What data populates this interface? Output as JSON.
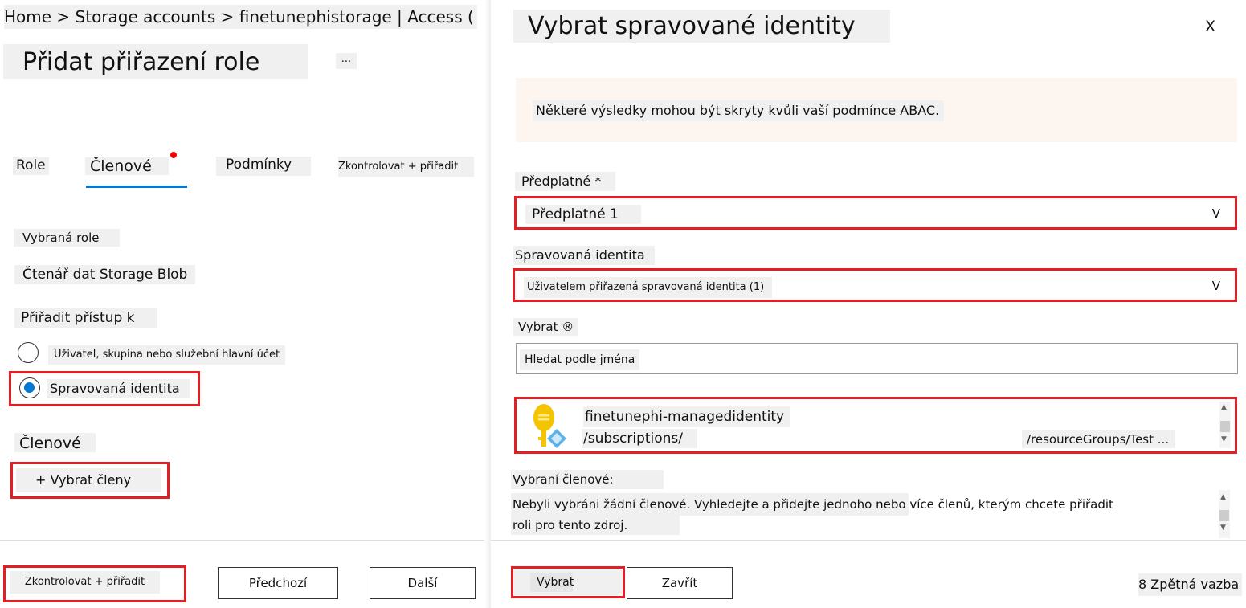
{
  "left": {
    "breadcrumb": "Home > Storage accounts > finetunephistorage | Access (",
    "title": "Přidat přiřazení role",
    "more": "...",
    "tabs": [
      "Role",
      "Členové",
      "Podmínky",
      "Zkontrolovat + přiřadit"
    ],
    "selected_role_label": "Vybraná role",
    "selected_role_value": "Čtenář dat Storage Blob",
    "assign_access_label": "Přiřadit přístup k",
    "radio_user": "Uživatel, skupina nebo služební hlavní účet",
    "radio_managed": "Spravovaná identita",
    "members_label": "Členové",
    "select_members": "+ Vybrat členy",
    "footer": {
      "review": "Zkontrolovat + přiřadit",
      "previous": "Předchozí",
      "next": "Další"
    }
  },
  "right": {
    "title": "Vybrat spravované identity",
    "close": "X",
    "notice": "Některé výsledky mohou být skryty kvůli vaší podmínce ABAC.",
    "subscription_label": "Předplatné *",
    "subscription_value": "Předplatné 1",
    "managed_identity_label": "Spravovaná identita",
    "managed_identity_value": "Uživatelem přiřazená spravovaná identita (1)",
    "select_label": "Vybrat ®",
    "search_placeholder": "Hledat podle jména",
    "result": {
      "name": "finetunephi-managedidentity",
      "path_start": "/subscriptions/",
      "path_end": "/resourceGroups/Test ..."
    },
    "selected_members_label": "Vybraní členové:",
    "selected_members_text_1": "Nebyli vybráni žádní členové. Vyhledejte a přidejte jednoho nebo více členů, kterým chcete přiřadit",
    "selected_members_text_2": "roli pro tento zdroj.",
    "footer": {
      "select": "Vybrat",
      "close": "Zavřít",
      "feedback": "8 Zpětná vazba"
    },
    "chevron": "V"
  },
  "colors": {
    "accent": "#0078d4",
    "highlight": "#e31e24",
    "notice_bg": "#fdf6f0"
  }
}
